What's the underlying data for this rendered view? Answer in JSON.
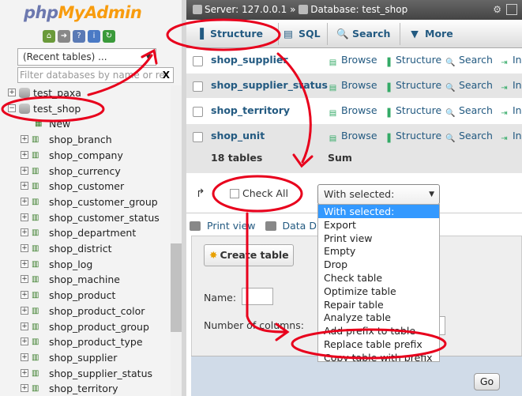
{
  "sidebar": {
    "logo_php": "php",
    "logo_rest": "MyAdmin",
    "quick_icons": [
      "home-icon",
      "exit-icon",
      "query-icon",
      "docs-icon",
      "reload-icon"
    ],
    "recent_tables": "(Recent tables) ...",
    "filter_placeholder": "Filter databases by name or re",
    "filter_clear": "X",
    "tree": [
      {
        "label": "test_paxa",
        "type": "db"
      },
      {
        "label": "test_shop",
        "type": "db"
      },
      {
        "label": "New",
        "type": "new"
      },
      {
        "label": "shop_branch",
        "type": "table"
      },
      {
        "label": "shop_company",
        "type": "table"
      },
      {
        "label": "shop_currency",
        "type": "table"
      },
      {
        "label": "shop_customer",
        "type": "table"
      },
      {
        "label": "shop_customer_group",
        "type": "table"
      },
      {
        "label": "shop_customer_status",
        "type": "table"
      },
      {
        "label": "shop_department",
        "type": "table"
      },
      {
        "label": "shop_district",
        "type": "table"
      },
      {
        "label": "shop_log",
        "type": "table"
      },
      {
        "label": "shop_machine",
        "type": "table"
      },
      {
        "label": "shop_product",
        "type": "table"
      },
      {
        "label": "shop_product_color",
        "type": "table"
      },
      {
        "label": "shop_product_group",
        "type": "table"
      },
      {
        "label": "shop_product_type",
        "type": "table"
      },
      {
        "label": "shop_supplier",
        "type": "table"
      },
      {
        "label": "shop_supplier_status",
        "type": "table"
      },
      {
        "label": "shop_territory",
        "type": "table"
      }
    ]
  },
  "breadcrumb": {
    "server": "Server: 127.0.0.1",
    "sep": "»",
    "database": "Database: test_shop"
  },
  "tabs": {
    "structure": "Structure",
    "sql": "SQL",
    "search": "Search",
    "more": "More"
  },
  "tables": [
    {
      "name": "shop_supplier",
      "browse": "Browse",
      "structure": "Structure",
      "search": "Search",
      "insert": "In"
    },
    {
      "name": "shop_supplier_status",
      "browse": "Browse",
      "structure": "Structure",
      "search": "Search",
      "insert": "In"
    },
    {
      "name": "shop_territory",
      "browse": "Browse",
      "structure": "Structure",
      "search": "Search",
      "insert": "In"
    },
    {
      "name": "shop_unit",
      "browse": "Browse",
      "structure": "Structure",
      "search": "Search",
      "insert": "In"
    }
  ],
  "summary": {
    "count": "18 tables",
    "sum": "Sum"
  },
  "bulk": {
    "check_all": "Check All",
    "with_selected": "With selected:"
  },
  "print": {
    "print_view": "Print view",
    "data_dict": "Data Dict"
  },
  "create": {
    "button": "Create table",
    "name_label": "Name:",
    "columns_label": "Number of columns:",
    "go": "Go"
  },
  "dropdown": {
    "options": [
      "With selected:",
      "Export",
      "Print view",
      "Empty",
      "Drop",
      "Check table",
      "Optimize table",
      "Repair table",
      "Analyze table",
      "Add prefix to table",
      "Replace table prefix",
      "Copy table with prefix"
    ],
    "selected_index": 0
  },
  "colors": {
    "link": "#235a81",
    "annotation": "#e8001c",
    "highlight": "#3399ff"
  }
}
